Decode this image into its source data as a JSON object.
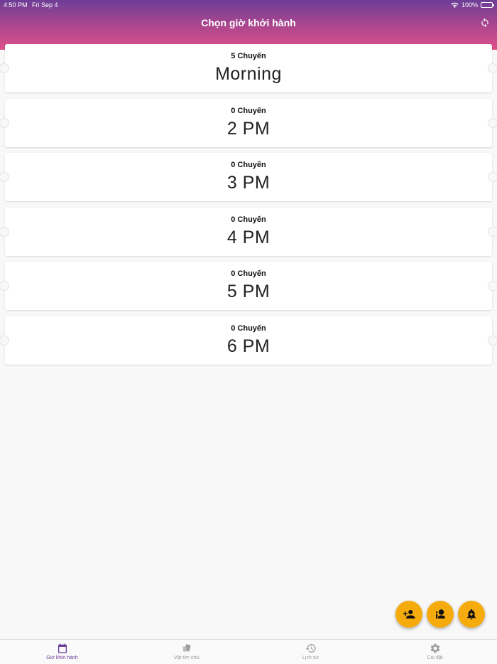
{
  "status_bar": {
    "time": "4:50 PM",
    "date": "Fri Sep 4",
    "battery": "100%"
  },
  "header": {
    "title": "Chọn giờ khởi hành",
    "refresh_icon": "refresh-icon"
  },
  "slots": [
    {
      "count": "5 Chuyến",
      "time": "Morning"
    },
    {
      "count": "0 Chuyến",
      "time": "2 PM"
    },
    {
      "count": "0 Chuyến",
      "time": "3 PM"
    },
    {
      "count": "0 Chuyến",
      "time": "4 PM"
    },
    {
      "count": "0 Chuyến",
      "time": "5 PM"
    },
    {
      "count": "0 Chuyến",
      "time": "6 PM"
    }
  ],
  "fabs": [
    {
      "icon": "add-person-icon"
    },
    {
      "icon": "person-info-icon"
    },
    {
      "icon": "bell-plus-icon"
    }
  ],
  "bottom_nav": [
    {
      "label": "Giờ khởi hành",
      "icon": "calendar-icon",
      "active": true
    },
    {
      "label": "Vật tìm chủ",
      "icon": "items-icon",
      "active": false
    },
    {
      "label": "Lịch sử",
      "icon": "history-icon",
      "active": false
    },
    {
      "label": "Cài đặt",
      "icon": "gear-icon",
      "active": false
    }
  ],
  "colors": {
    "header_top": "#6d3e97",
    "header_bottom": "#e0508a",
    "fab": "#f5ab0c",
    "active_nav": "#6d3e97"
  }
}
